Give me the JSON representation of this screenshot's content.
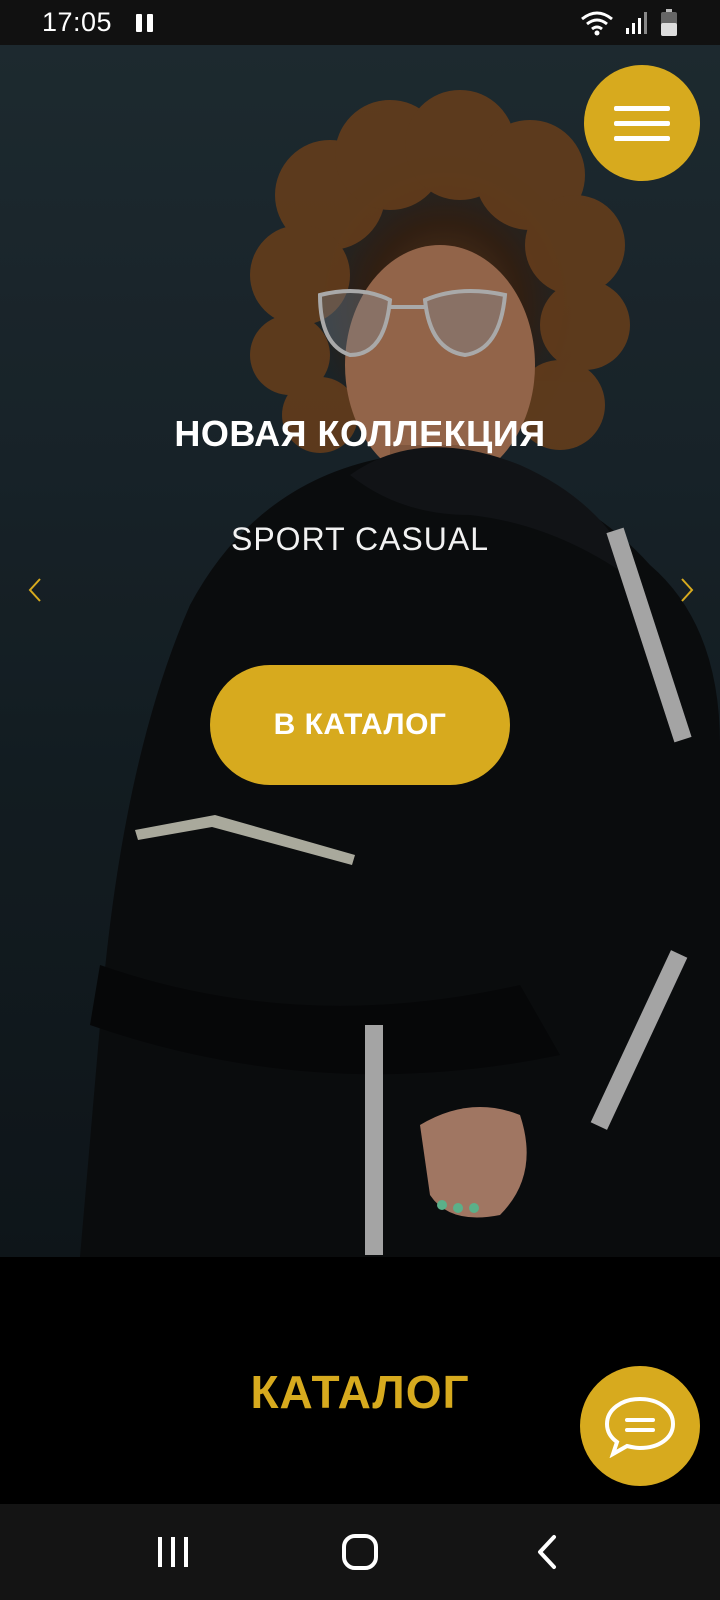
{
  "status_bar": {
    "time": "17:05",
    "icons": [
      "pause-icon",
      "wifi-icon",
      "signal-icon",
      "battery-icon"
    ]
  },
  "header": {
    "menu_icon": "hamburger-menu-icon"
  },
  "hero": {
    "title": "НОВАЯ КОЛЛЕКЦИЯ",
    "subtitle": "SPORT CASUAL",
    "cta_label": "В КАТАЛОГ",
    "prev_icon": "chevron-left-icon",
    "next_icon": "chevron-right-icon"
  },
  "catalog": {
    "heading": "КАТАЛОГ"
  },
  "chat": {
    "icon": "chat-bubble-icon"
  },
  "nav_bar": {
    "icons": [
      "recent-apps-icon",
      "home-icon",
      "back-icon"
    ]
  },
  "colors": {
    "accent": "#d7aa1e",
    "status_bar": "#111111",
    "nav_bar": "#141414",
    "background": "#000000"
  }
}
